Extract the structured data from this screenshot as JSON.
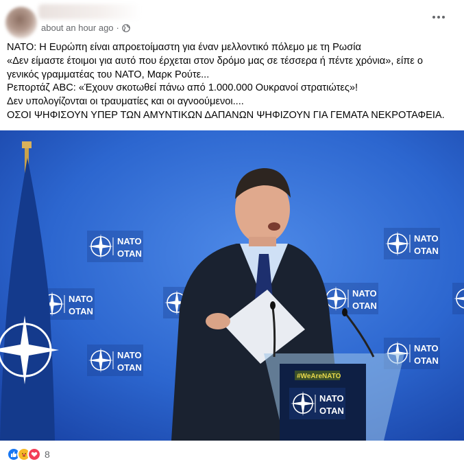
{
  "post": {
    "timestamp": "about an hour ago",
    "separator": "·",
    "privacy_icon": "globe-icon",
    "more_icon": "more-options-icon",
    "text_lines": [
      "ΝΑΤΟ: Η Ευρώπη είναι απροετοίμαστη για έναν μελλοντικό πόλεμο με τη Ρωσία",
      "«Δεν είμαστε έτοιμοι για αυτό που έρχεται στον δρόμο μας σε τέσσερα ή πέντε χρόνια», είπε ο",
      "γενικός γραμματέας του ΝΑΤΟ, Μαρκ Ρούτε...",
      "Ρεπορτάζ ABC: «Έχουν σκοτωθεί πάνω από 1.000.000 Ουκρανοί στρατιώτες»!",
      "Δεν υπολογίζονται οι τραυματίες και οι αγνοούμενοι....",
      "ΟΣΟΙ ΨΗΦΙΣΟΥΝ ΥΠΕΡ ΤΩΝ ΑΜΥΝΤΙΚΩΝ ΔΑΠΑΝΩΝ ΨΗΦΙΖΟΥΝ ΓΙΑ ΓΕΜΑΤΑ ΝΕΚΡΟΤΑΦΕΙΑ."
    ]
  },
  "photo": {
    "backdrop_logo_top": "NATO",
    "backdrop_logo_bottom": "OTAN",
    "podium_tag": "#WeAreNATO",
    "podium_logo_top": "NATO",
    "podium_logo_bottom": "OTAN"
  },
  "reactions": {
    "icons": [
      "like-icon",
      "care-icon",
      "love-icon"
    ],
    "count": "8"
  },
  "colors": {
    "backdrop_blue": "#1f5cc8",
    "meta_gray": "#65676b",
    "like_blue": "#1877f2",
    "love_red": "#f33e58",
    "care_yellow": "#f7b928"
  }
}
